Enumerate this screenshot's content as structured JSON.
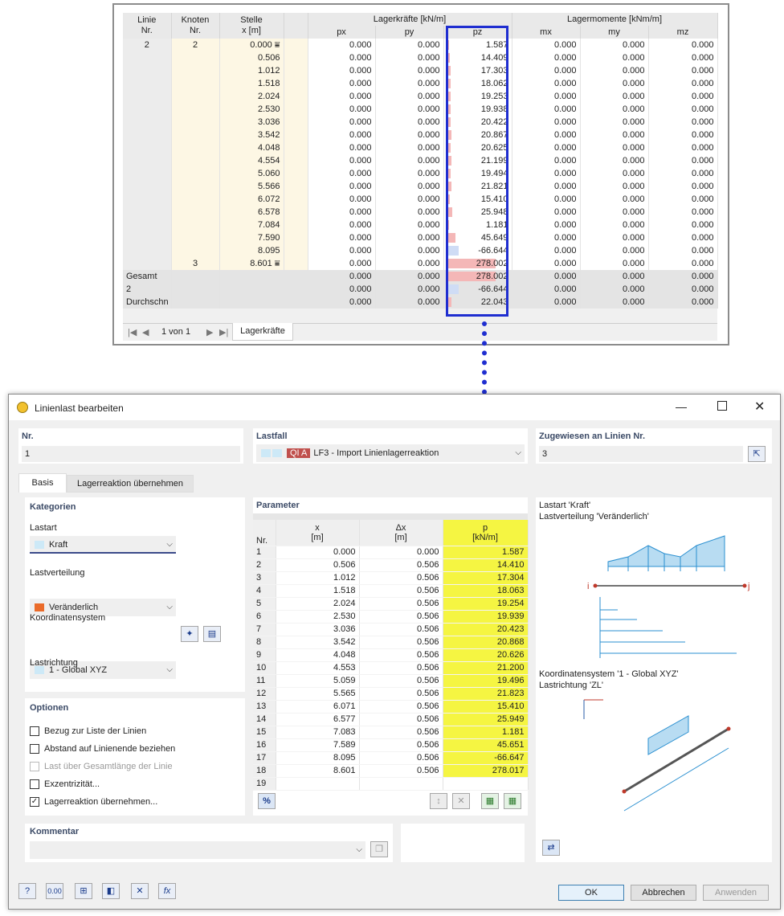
{
  "results": {
    "headers": {
      "linie": "Linie",
      "linie2": "Nr.",
      "knoten": "Knoten",
      "knoten2": "Nr.",
      "stelle": "Stelle",
      "stelle2": "x [m]",
      "lagerkraefte": "Lagerkräfte [kN/m]",
      "lagermomente": "Lagermomente [kNm/m]",
      "px": "px",
      "py": "py",
      "pz": "pz",
      "mx": "mx",
      "my": "my",
      "mz": "mz"
    },
    "rows": [
      {
        "linie": "2",
        "knoten": "2",
        "x": "0.000",
        "px": "0.000",
        "py": "0.000",
        "pz": "1.587",
        "pzv": 1.587,
        "mx": "0.000",
        "my": "0.000",
        "mz": "0.000",
        "mark": true
      },
      {
        "linie": "",
        "knoten": "",
        "x": "0.506",
        "px": "0.000",
        "py": "0.000",
        "pz": "14.409",
        "pzv": 14.409,
        "mx": "0.000",
        "my": "0.000",
        "mz": "0.000"
      },
      {
        "linie": "",
        "knoten": "",
        "x": "1.012",
        "px": "0.000",
        "py": "0.000",
        "pz": "17.303",
        "pzv": 17.303,
        "mx": "0.000",
        "my": "0.000",
        "mz": "0.000"
      },
      {
        "linie": "",
        "knoten": "",
        "x": "1.518",
        "px": "0.000",
        "py": "0.000",
        "pz": "18.062",
        "pzv": 18.062,
        "mx": "0.000",
        "my": "0.000",
        "mz": "0.000"
      },
      {
        "linie": "",
        "knoten": "",
        "x": "2.024",
        "px": "0.000",
        "py": "0.000",
        "pz": "19.253",
        "pzv": 19.253,
        "mx": "0.000",
        "my": "0.000",
        "mz": "0.000"
      },
      {
        "linie": "",
        "knoten": "",
        "x": "2.530",
        "px": "0.000",
        "py": "0.000",
        "pz": "19.938",
        "pzv": 19.938,
        "mx": "0.000",
        "my": "0.000",
        "mz": "0.000"
      },
      {
        "linie": "",
        "knoten": "",
        "x": "3.036",
        "px": "0.000",
        "py": "0.000",
        "pz": "20.422",
        "pzv": 20.422,
        "mx": "0.000",
        "my": "0.000",
        "mz": "0.000"
      },
      {
        "linie": "",
        "knoten": "",
        "x": "3.542",
        "px": "0.000",
        "py": "0.000",
        "pz": "20.867",
        "pzv": 20.867,
        "mx": "0.000",
        "my": "0.000",
        "mz": "0.000"
      },
      {
        "linie": "",
        "knoten": "",
        "x": "4.048",
        "px": "0.000",
        "py": "0.000",
        "pz": "20.625",
        "pzv": 20.625,
        "mx": "0.000",
        "my": "0.000",
        "mz": "0.000"
      },
      {
        "linie": "",
        "knoten": "",
        "x": "4.554",
        "px": "0.000",
        "py": "0.000",
        "pz": "21.199",
        "pzv": 21.199,
        "mx": "0.000",
        "my": "0.000",
        "mz": "0.000"
      },
      {
        "linie": "",
        "knoten": "",
        "x": "5.060",
        "px": "0.000",
        "py": "0.000",
        "pz": "19.494",
        "pzv": 19.494,
        "mx": "0.000",
        "my": "0.000",
        "mz": "0.000"
      },
      {
        "linie": "",
        "knoten": "",
        "x": "5.566",
        "px": "0.000",
        "py": "0.000",
        "pz": "21.821",
        "pzv": 21.821,
        "mx": "0.000",
        "my": "0.000",
        "mz": "0.000"
      },
      {
        "linie": "",
        "knoten": "",
        "x": "6.072",
        "px": "0.000",
        "py": "0.000",
        "pz": "15.410",
        "pzv": 15.41,
        "mx": "0.000",
        "my": "0.000",
        "mz": "0.000"
      },
      {
        "linie": "",
        "knoten": "",
        "x": "6.578",
        "px": "0.000",
        "py": "0.000",
        "pz": "25.948",
        "pzv": 25.948,
        "mx": "0.000",
        "my": "0.000",
        "mz": "0.000"
      },
      {
        "linie": "",
        "knoten": "",
        "x": "7.084",
        "px": "0.000",
        "py": "0.000",
        "pz": "1.181",
        "pzv": 1.181,
        "mx": "0.000",
        "my": "0.000",
        "mz": "0.000"
      },
      {
        "linie": "",
        "knoten": "",
        "x": "7.590",
        "px": "0.000",
        "py": "0.000",
        "pz": "45.649",
        "pzv": 45.649,
        "mx": "0.000",
        "my": "0.000",
        "mz": "0.000"
      },
      {
        "linie": "",
        "knoten": "",
        "x": "8.095",
        "px": "0.000",
        "py": "0.000",
        "pz": "-66.644",
        "pzv": -66.644,
        "mx": "0.000",
        "my": "0.000",
        "mz": "0.000"
      },
      {
        "linie": "",
        "knoten": "3",
        "x": "8.601",
        "px": "0.000",
        "py": "0.000",
        "pz": "278.002",
        "pzv": 278.002,
        "mx": "0.000",
        "my": "0.000",
        "mz": "0.000",
        "mark": true
      }
    ],
    "summary": [
      {
        "label": "Gesamt",
        "px": "0.000",
        "py": "0.000",
        "pz": "278.002",
        "pzv": 278.002,
        "mx": "0.000",
        "my": "0.000",
        "mz": "0.000"
      },
      {
        "label": "2",
        "px": "0.000",
        "py": "0.000",
        "pz": "-66.644",
        "pzv": -66.644,
        "mx": "0.000",
        "my": "0.000",
        "mz": "0.000"
      },
      {
        "label": "Durchschn",
        "px": "0.000",
        "py": "0.000",
        "pz": "22.043",
        "pzv": 22.043,
        "mx": "0.000",
        "my": "0.000",
        "mz": "0.000"
      }
    ],
    "footer": {
      "pager": "1 von 1",
      "tab": "Lagerkräfte"
    }
  },
  "dialog": {
    "title": "Linienlast bearbeiten",
    "nr_label": "Nr.",
    "nr_value": "1",
    "lastfall_label": "Lastfall",
    "lastfall_badge": "QI A",
    "lastfall_value": "LF3 - Import Linienlagerreaktion",
    "zugewiesen_label": "Zugewiesen an Linien Nr.",
    "zugewiesen_value": "3",
    "tabs": [
      "Basis",
      "Lagerreaktion übernehmen"
    ],
    "kategorien": "Kategorien",
    "lastart_label": "Lastart",
    "lastart_value": "Kraft",
    "lastverteilung_label": "Lastverteilung",
    "lastverteilung_value": "Veränderlich",
    "koord_label": "Koordinatensystem",
    "koord_value": "1 - Global XYZ",
    "lastrichtung_label": "Lastrichtung",
    "lastrichtung_value": "ZL",
    "optionen": "Optionen",
    "options": [
      {
        "label": "Bezug zur Liste der Linien",
        "checked": false,
        "disabled": false
      },
      {
        "label": "Abstand auf Linienende beziehen",
        "checked": false,
        "disabled": false
      },
      {
        "label": "Last über Gesamtlänge der Linie",
        "checked": false,
        "disabled": true
      },
      {
        "label": "Exzentrizität...",
        "checked": false,
        "disabled": false
      },
      {
        "label": "Lagerreaktion übernehmen...",
        "checked": true,
        "disabled": false
      }
    ],
    "kommentar": "Kommentar",
    "parameter": "Parameter",
    "param_headers": {
      "nr": "Nr.",
      "x": "x",
      "x_unit": "[m]",
      "dx": "Δx",
      "dx_unit": "[m]",
      "p": "p",
      "p_unit": "[kN/m]"
    },
    "params": [
      [
        "1",
        "0.000",
        "0.000",
        "1.587"
      ],
      [
        "2",
        "0.506",
        "0.506",
        "14.410"
      ],
      [
        "3",
        "1.012",
        "0.506",
        "17.304"
      ],
      [
        "4",
        "1.518",
        "0.506",
        "18.063"
      ],
      [
        "5",
        "2.024",
        "0.506",
        "19.254"
      ],
      [
        "6",
        "2.530",
        "0.506",
        "19.939"
      ],
      [
        "7",
        "3.036",
        "0.506",
        "20.423"
      ],
      [
        "8",
        "3.542",
        "0.506",
        "20.868"
      ],
      [
        "9",
        "4.048",
        "0.506",
        "20.626"
      ],
      [
        "10",
        "4.553",
        "0.506",
        "21.200"
      ],
      [
        "11",
        "5.059",
        "0.506",
        "19.496"
      ],
      [
        "12",
        "5.565",
        "0.506",
        "21.823"
      ],
      [
        "13",
        "6.071",
        "0.506",
        "15.410"
      ],
      [
        "14",
        "6.577",
        "0.506",
        "25.949"
      ],
      [
        "15",
        "7.083",
        "0.506",
        "1.181"
      ],
      [
        "16",
        "7.589",
        "0.506",
        "45.651"
      ],
      [
        "17",
        "8.095",
        "0.506",
        "-66.647"
      ],
      [
        "18",
        "8.601",
        "0.506",
        "278.017"
      ],
      [
        "19",
        "",
        "",
        ""
      ]
    ],
    "preview_text1": "Lastart 'Kraft'",
    "preview_text2": "Lastverteilung 'Veränderlich'",
    "preview_text3": "Koordinatensystem '1 - Global XYZ'",
    "preview_text4": "Lastrichtung 'ZL'",
    "buttons": {
      "ok": "OK",
      "cancel": "Abbrechen",
      "apply": "Anwenden"
    }
  }
}
